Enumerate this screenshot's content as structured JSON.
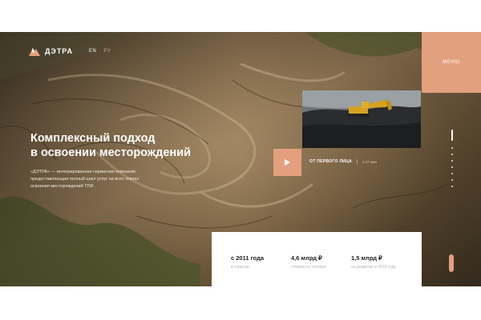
{
  "header": {
    "logo_text": "ДЭТРА",
    "languages": [
      {
        "code": "EN",
        "active": true
      },
      {
        "code": "РУ",
        "active": false
      }
    ],
    "menu_label": "МЕНЮ"
  },
  "hero": {
    "headline_line1": "Комплексный подход",
    "headline_line2": "в освоении месторождений",
    "description": "«ДЭТРА» — интегрированная сервисная компания, предоставляющая полный цикл услуг на всех этапах освоения месторождений ТПИ."
  },
  "video": {
    "title": "ОТ ПЕРВОГО ЛИЦА",
    "duration": "1:47 мин"
  },
  "stats": [
    {
      "value": "с 2011 года",
      "label": "в отрасли"
    },
    {
      "value": "4,6 млрд ₽",
      "label": "стоимость техники"
    },
    {
      "value": "1,5 млрд ₽",
      "label": "на развитие в 2018 году"
    }
  ],
  "colors": {
    "accent": "#e3a07e",
    "terrain_dark": "#3f3323",
    "terrain_light": "#a38866",
    "vegetation": "#4f5a2c"
  },
  "icons": {
    "logo": "mountain-logo-icon",
    "play": "play-icon"
  },
  "pager": {
    "total": 8,
    "active": 1
  }
}
